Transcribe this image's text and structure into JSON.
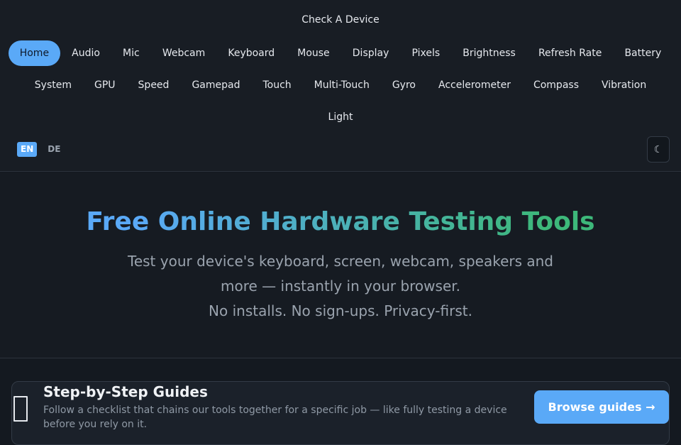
{
  "brand": "Check A Device",
  "nav": {
    "row1": [
      "Home",
      "Audio",
      "Mic",
      "Webcam",
      "Keyboard",
      "Mouse",
      "Display",
      "Pixels",
      "Brightness",
      "Refresh Rate",
      "Battery"
    ],
    "row2": [
      "System",
      "GPU",
      "Speed",
      "Gamepad",
      "Touch",
      "Multi-Touch",
      "Gyro",
      "Accelerometer",
      "Compass",
      "Vibration"
    ],
    "row3": [
      "Light"
    ],
    "active": "Home"
  },
  "lang": {
    "en": "EN",
    "de": "DE",
    "active": "EN"
  },
  "theme_toggle": {
    "icon": "moon-icon",
    "glyph": "☾"
  },
  "hero": {
    "title": "Free Online Hardware Testing Tools",
    "subtitle_line1": "Test your device's keyboard, screen, webcam, speakers and more — instantly in your browser.",
    "subtitle_line2": "No installs. No sign-ups. Privacy-first."
  },
  "guides_card": {
    "icon": "phone-icon",
    "title": "Step-by-Step Guides",
    "description": "Follow a checklist that chains our tools together for a specific job — like fully testing a device before you rely on it.",
    "button": "Browse guides →"
  },
  "colors": {
    "accent": "#5aa9f7",
    "gradient_end": "#3db87a",
    "background": "#141920"
  }
}
